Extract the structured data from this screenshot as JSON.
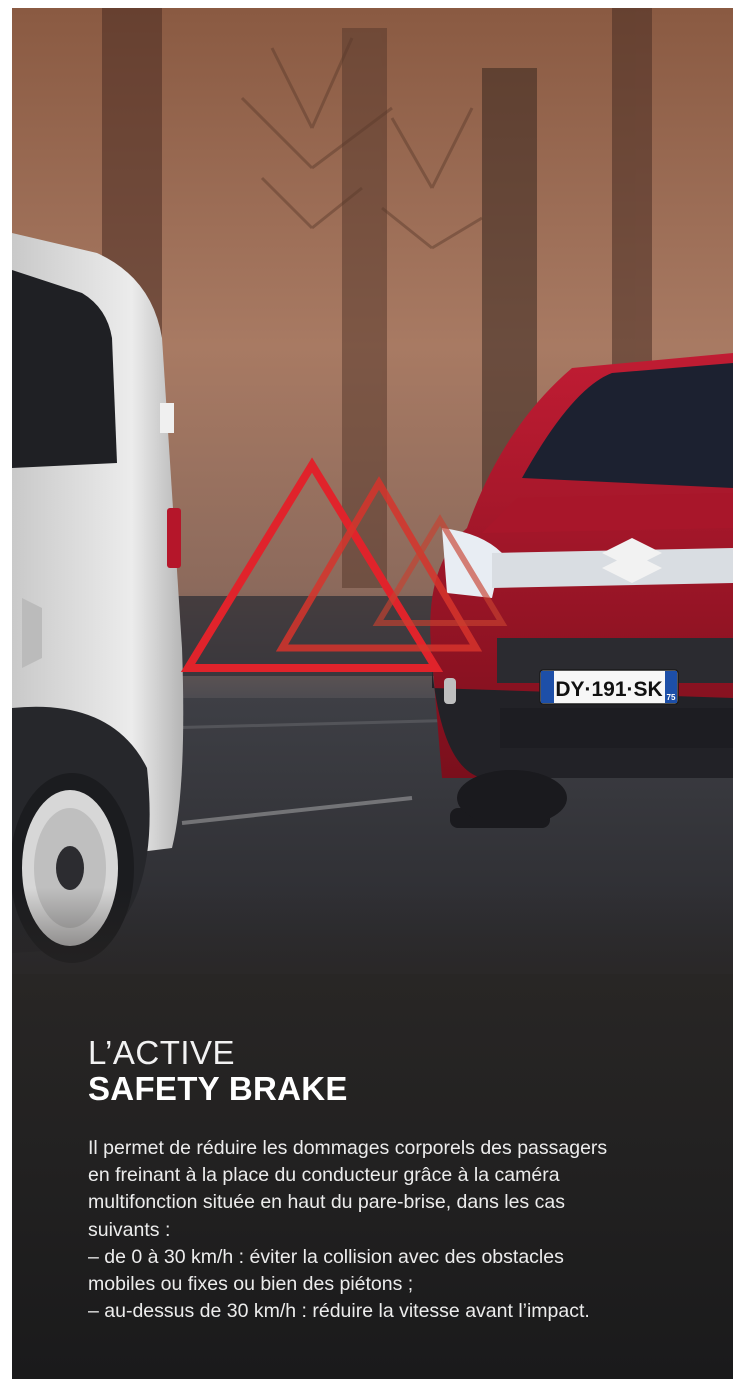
{
  "heading": {
    "line1": "L’ACTIVE",
    "line2": "SAFETY BRAKE"
  },
  "body": {
    "lines": [
      "Il permet de réduire les dommages corporels des passagers",
      "en freinant à la place du conducteur grâce à la caméra",
      "multifonction située en haut du pare-brise, dans les cas",
      "suivants :",
      "– de 0 à 30 km/h : éviter la collision avec des obstacles",
      "mobiles ou fixes ou bien des piétons ;",
      "– au-dessus de 30 km/h : réduire la vitesse avant l’impact."
    ]
  },
  "photo": {
    "license_plate": "DY·191·SK",
    "plate_region": "75",
    "warning_symbol": "warning-triangle-icon",
    "colors": {
      "triangle_red": "#e0232b",
      "van_red": "#b0152a",
      "van_white": "#d9d9d9"
    }
  }
}
